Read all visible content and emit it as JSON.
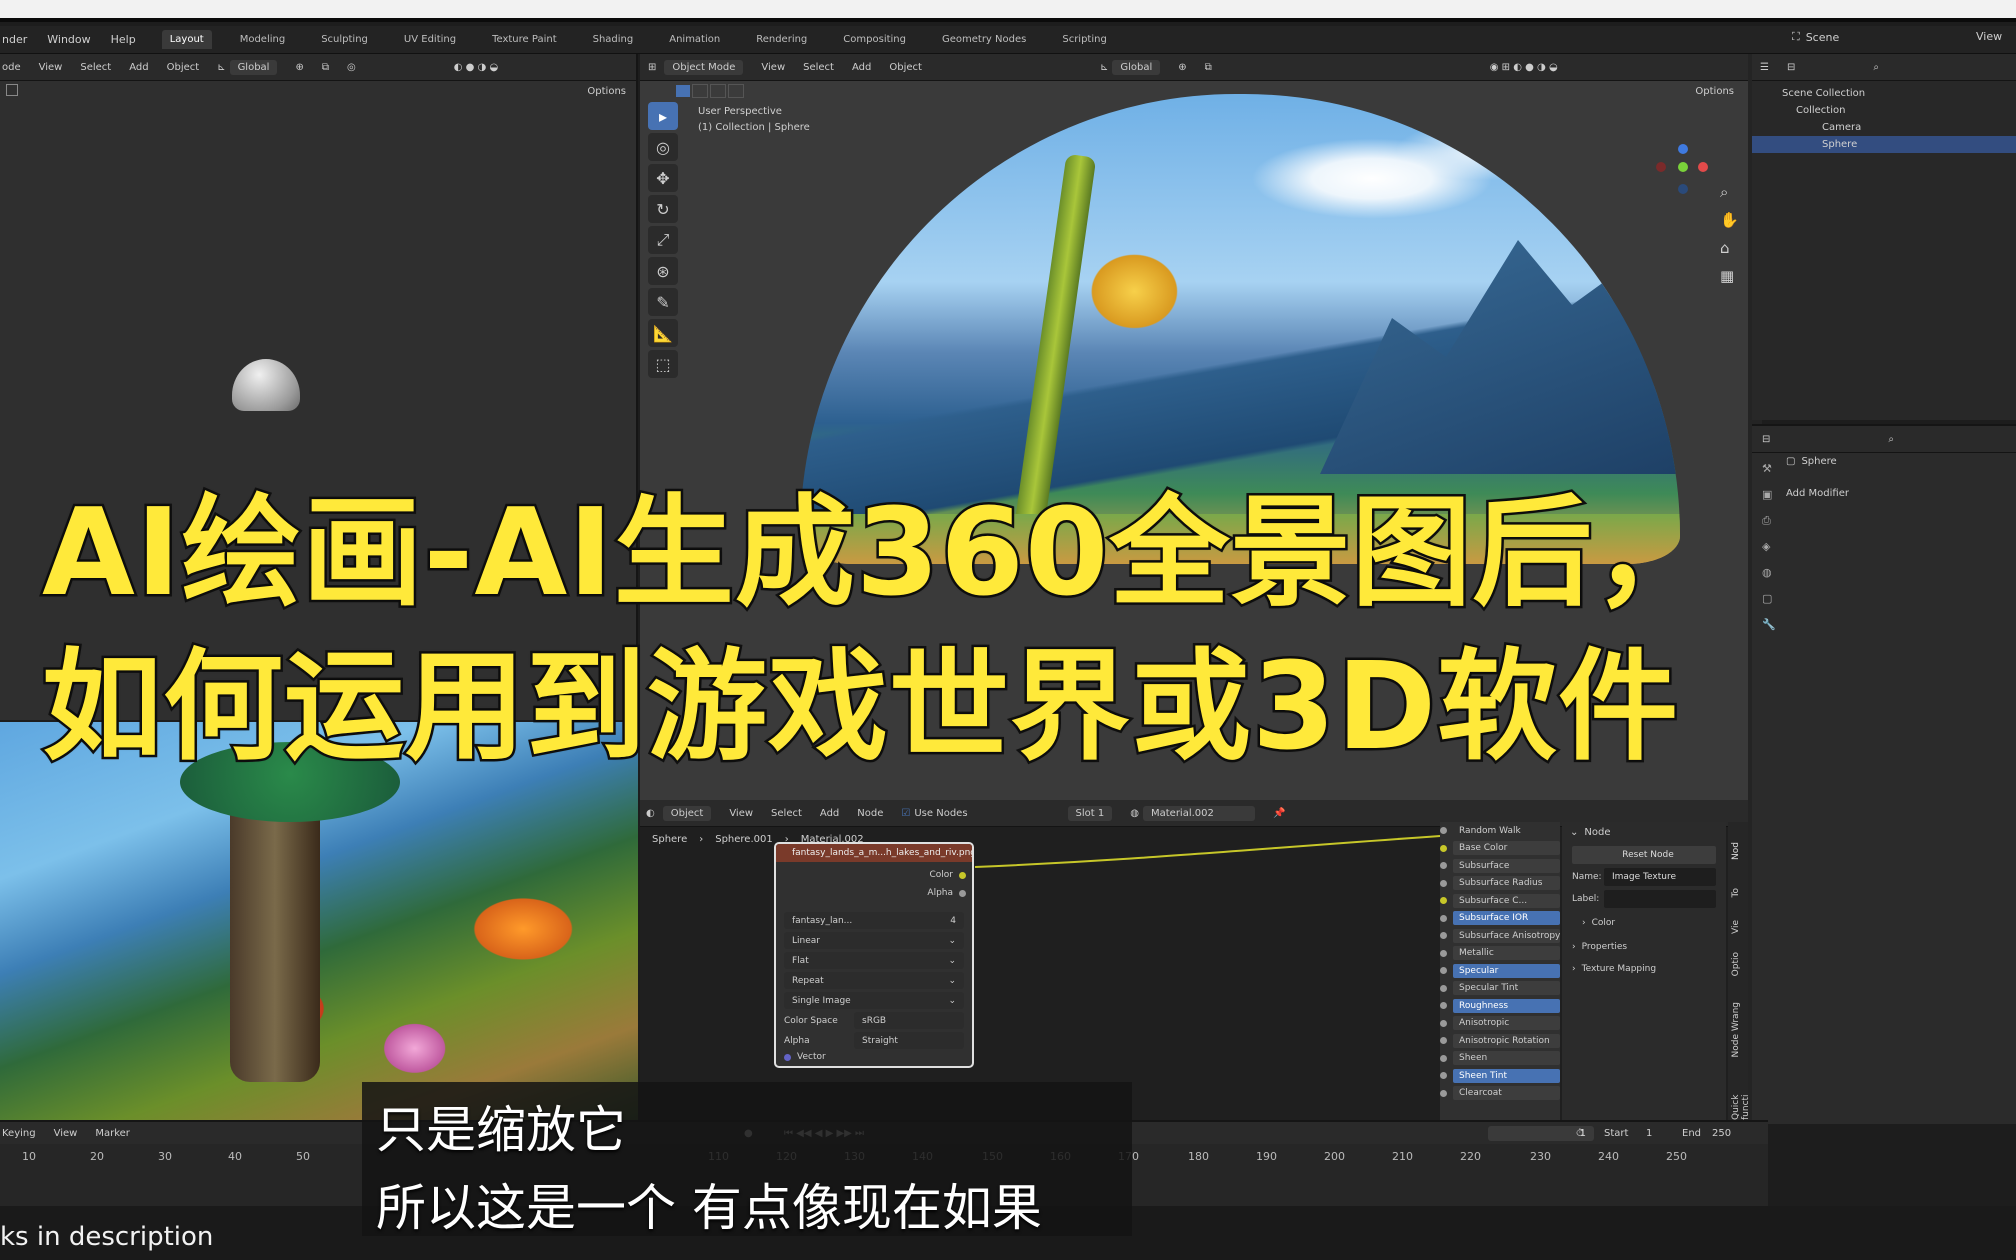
{
  "menubar": {
    "items": [
      "nder",
      "Window",
      "Help"
    ],
    "workspace_tabs": [
      "Layout",
      "Modeling",
      "Sculpting",
      "UV Editing",
      "Texture Paint",
      "Shading",
      "Animation",
      "Rendering",
      "Compositing",
      "Geometry Nodes",
      "Scripting"
    ],
    "scene_label": "Scene",
    "view_layer_label": "View"
  },
  "left_viewport": {
    "header_items": [
      "ode",
      "View",
      "Select",
      "Add",
      "Object"
    ],
    "orientation": "Global",
    "options_label": "Options"
  },
  "main_viewport": {
    "mode": "Object Mode",
    "header_items": [
      "View",
      "Select",
      "Add",
      "Object"
    ],
    "orientation": "Global",
    "options_label": "Options",
    "view_name": "User Perspective",
    "view_collection": "(1) Collection | Sphere"
  },
  "outliner": {
    "items": [
      "Scene Collection",
      "Collection",
      "Camera",
      "Sphere"
    ]
  },
  "properties": {
    "object_name": "Sphere",
    "add_modifier": "Add Modifier"
  },
  "node_editor": {
    "header": {
      "mode": "Object",
      "menus": [
        "View",
        "Select",
        "Add",
        "Node"
      ],
      "use_nodes": "Use Nodes",
      "slot": "Slot 1",
      "material": "Material.002"
    },
    "breadcrumb": [
      "Sphere",
      "Sphere.001",
      "Material.002"
    ],
    "image_node": {
      "title": "fantasy_lands_a_m...h_lakes_and_riv.png",
      "outputs": [
        "Color",
        "Alpha"
      ],
      "image_name": "fantasy_lan...",
      "users": "4",
      "interpolation": "Linear",
      "projection": "Flat",
      "extension": "Repeat",
      "source": "Single Image",
      "color_space_label": "Color Space",
      "color_space": "sRGB",
      "alpha_label": "Alpha",
      "alpha_mode": "Straight",
      "vector_label": "Vector"
    },
    "bsdf_rows": [
      {
        "label": "Random Walk",
        "style": "plain"
      },
      {
        "label": "Base Color",
        "style": "color"
      },
      {
        "label": "Subsurface",
        "style": "field"
      },
      {
        "label": "Subsurface Radius",
        "style": "field"
      },
      {
        "label": "Subsurface C...",
        "style": "color"
      },
      {
        "label": "Subsurface IOR",
        "style": "blue"
      },
      {
        "label": "Subsurface Anisotropy",
        "style": "field"
      },
      {
        "label": "Metallic",
        "style": "field"
      },
      {
        "label": "Specular",
        "style": "blue"
      },
      {
        "label": "Specular Tint",
        "style": "field"
      },
      {
        "label": "Roughness",
        "style": "blue"
      },
      {
        "label": "Anisotropic",
        "style": "field"
      },
      {
        "label": "Anisotropic Rotation",
        "style": "field"
      },
      {
        "label": "Sheen",
        "style": "field"
      },
      {
        "label": "Sheen Tint",
        "style": "blue"
      },
      {
        "label": "Clearcoat",
        "style": "field"
      }
    ],
    "sidebar": {
      "section": "Node",
      "reset": "Reset Node",
      "name_label": "Name:",
      "name_value": "Image Texture",
      "label_label": "Label:",
      "color_label": "Color",
      "properties_label": "Properties",
      "texture_mapping_label": "Texture Mapping",
      "tabs": [
        "Nod",
        "To",
        "Vie",
        "Optio",
        "Node Wrang",
        "Quick functi"
      ]
    }
  },
  "timeline": {
    "menus": [
      "Keying",
      "View",
      "Marker"
    ],
    "current_frame": "1",
    "start_label": "Start",
    "start_value": "1",
    "end_label": "End",
    "end_value": "250",
    "ticks": [
      "10",
      "20",
      "30",
      "40",
      "50",
      "110",
      "120",
      "130",
      "140",
      "150",
      "160",
      "170",
      "180",
      "190",
      "200",
      "210",
      "220",
      "230",
      "240",
      "250"
    ]
  },
  "overlay": {
    "title_line1": "AI绘画-AI生成360全景图后，",
    "title_line2": "如何运用到游戏世界或3D软件",
    "subtitle_line1": "只是缩放它",
    "subtitle_line2": "所以这是一个 有点像现在如果",
    "bottom_caption": "ks in description",
    "title_color": "#ffe93a"
  }
}
